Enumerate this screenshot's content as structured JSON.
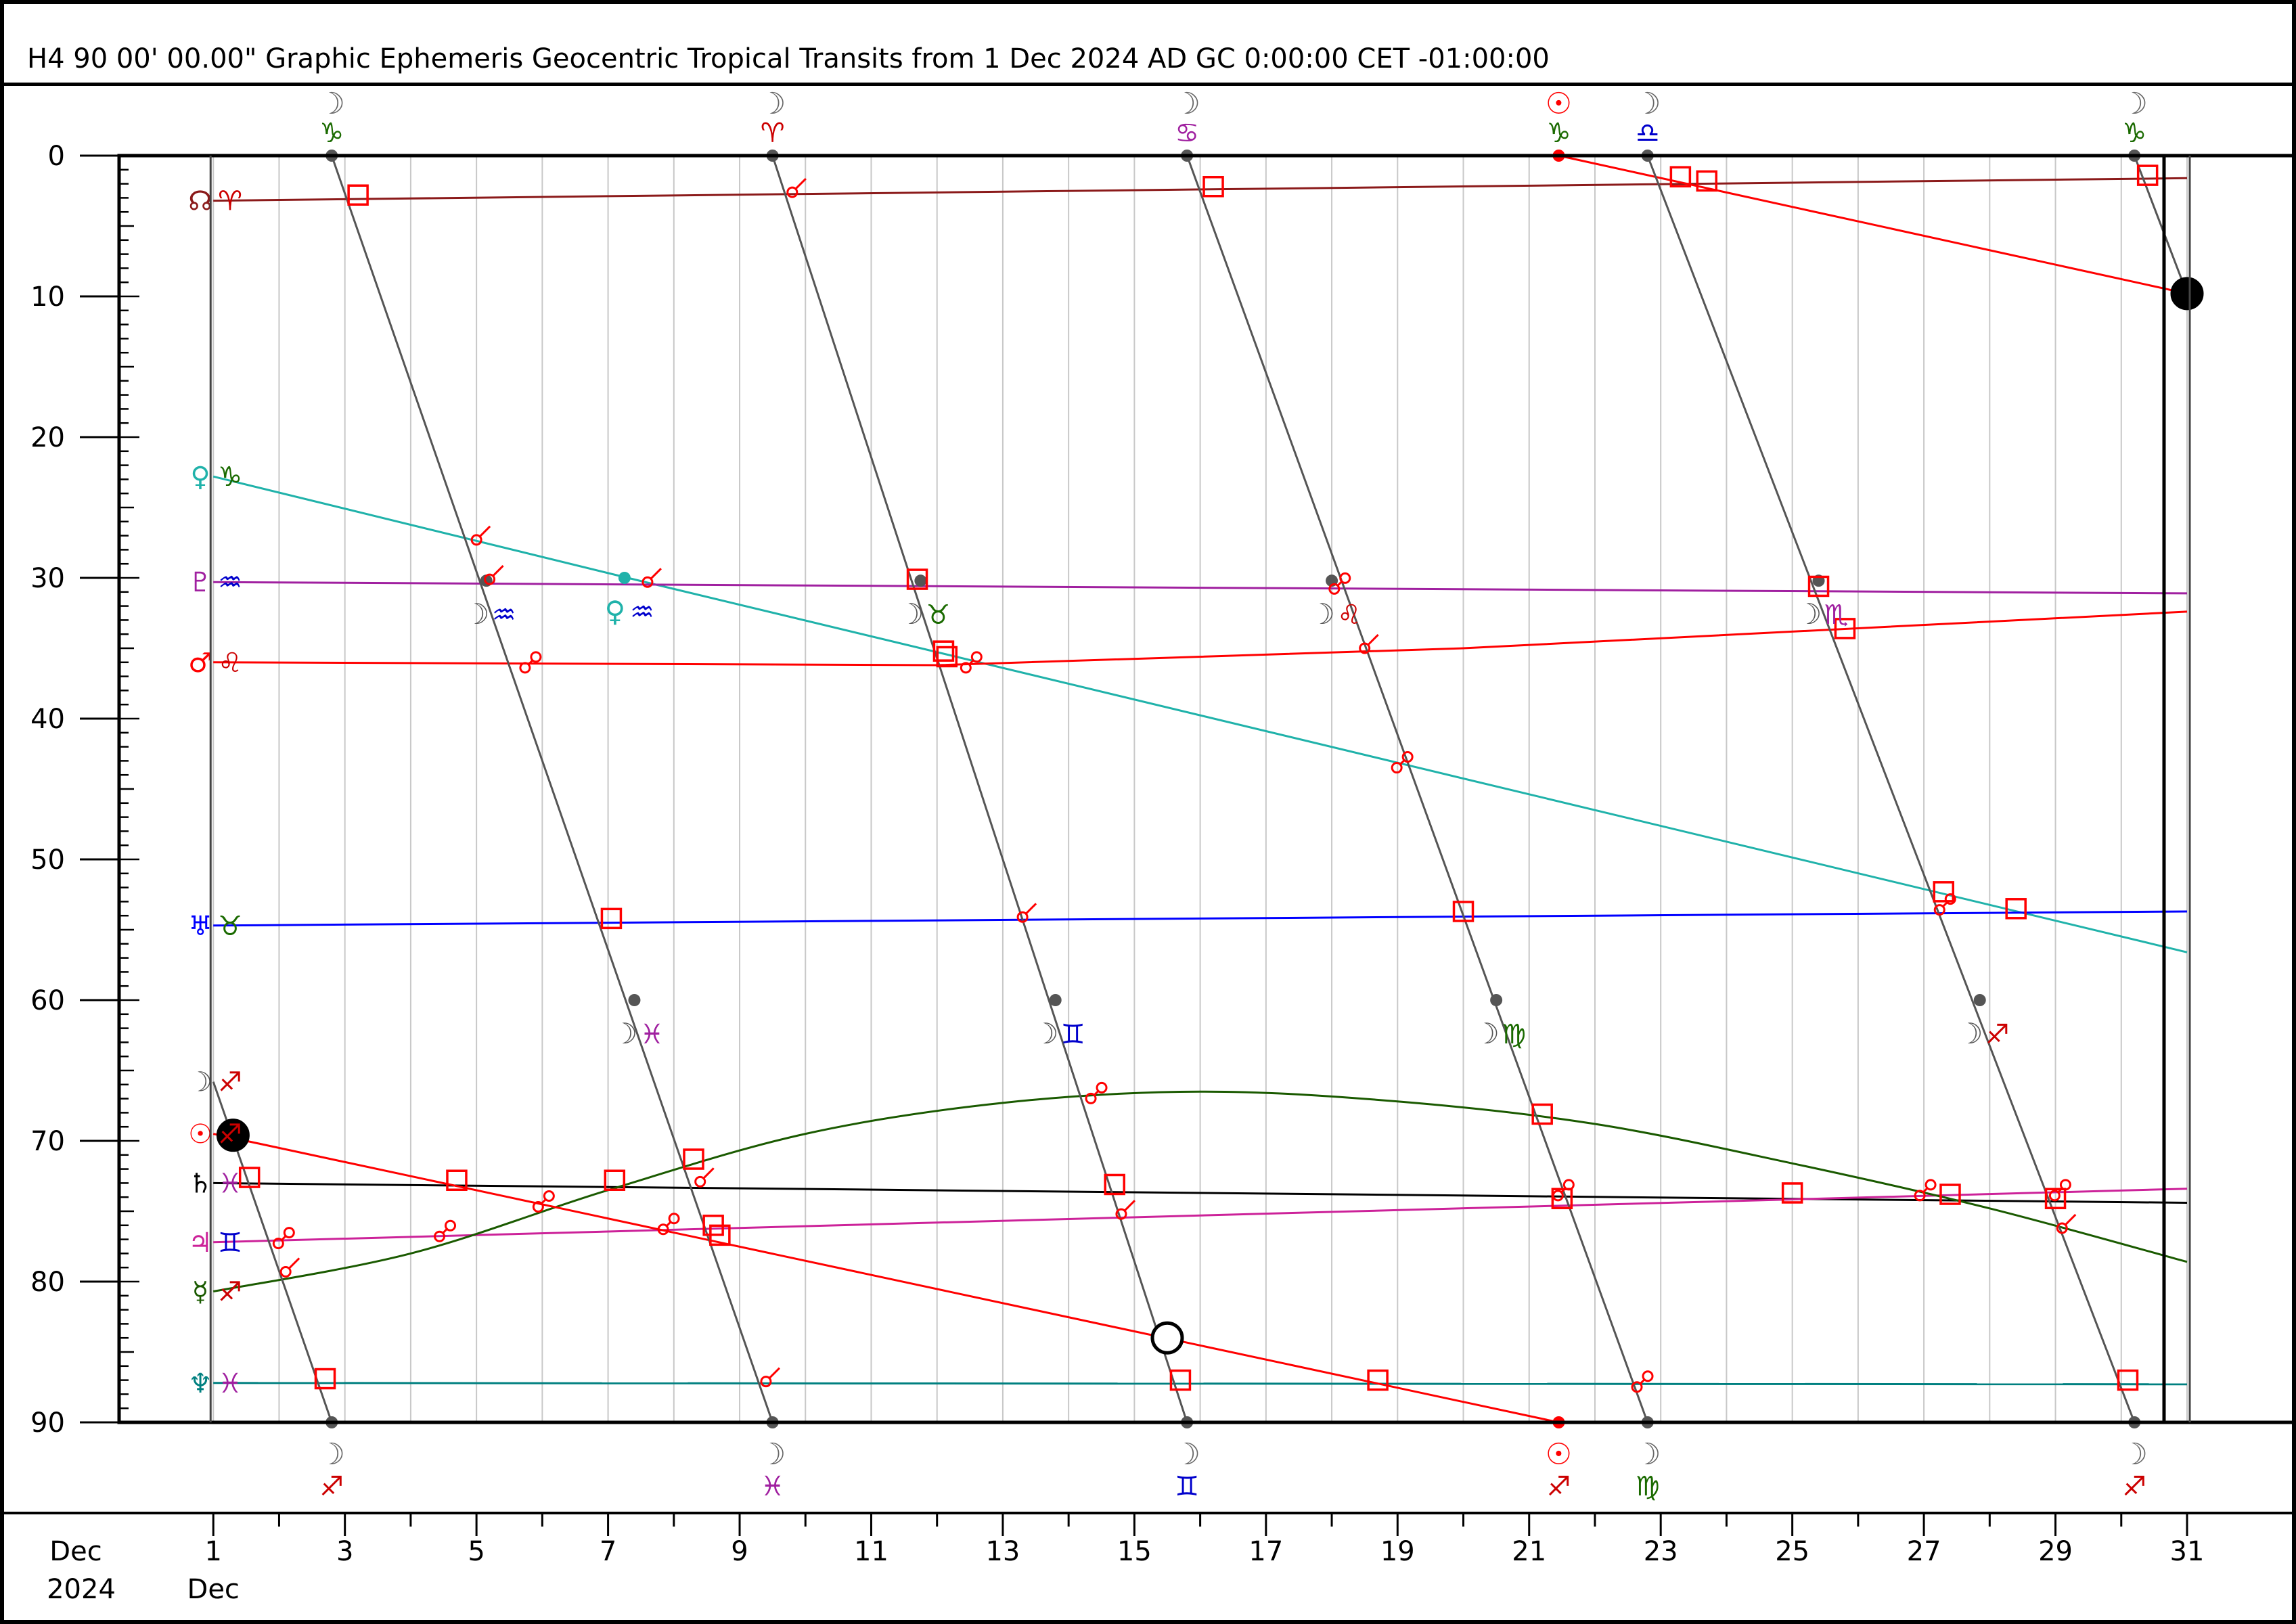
{
  "title": "H4   90 00' 00.00\" Graphic Ephemeris Geocentric Tropical Transits from 1 Dec 2024 AD GC 0:00:00 CET -01:00:00",
  "colors": {
    "moon": "#555555",
    "sun": "#ff0000",
    "venus": "#20b2aa",
    "pluto": "#a020a0",
    "mars": "#ff0000",
    "uranus": "#0000ff",
    "saturn": "#000000",
    "jupiter": "#cc2299",
    "mercury": "#1a5a00",
    "neptune": "#008080",
    "node": "#8b1a1a",
    "aspect": "#ff0000",
    "grid": "#c8c8c8"
  },
  "chart_data": {
    "type": "line",
    "xlabel": "",
    "ylabel": "",
    "xlim": [
      0,
      31
    ],
    "ylim": [
      0,
      90
    ],
    "x_tick_labels": [
      {
        "day": 1,
        "label": "1",
        "sub": "Dec"
      },
      {
        "day": 3,
        "label": "3"
      },
      {
        "day": 5,
        "label": "5"
      },
      {
        "day": 7,
        "label": "7"
      },
      {
        "day": 9,
        "label": "9"
      },
      {
        "day": 11,
        "label": "11"
      },
      {
        "day": 13,
        "label": "13"
      },
      {
        "day": 15,
        "label": "15"
      },
      {
        "day": 17,
        "label": "17"
      },
      {
        "day": 19,
        "label": "19"
      },
      {
        "day": 21,
        "label": "21"
      },
      {
        "day": 23,
        "label": "23"
      },
      {
        "day": 25,
        "label": "25"
      },
      {
        "day": 27,
        "label": "27"
      },
      {
        "day": 29,
        "label": "29"
      },
      {
        "day": 31,
        "label": "31"
      }
    ],
    "x_corner_label": [
      "Dec",
      "2024"
    ],
    "y_ticks": [
      0,
      10,
      20,
      30,
      40,
      50,
      60,
      70,
      80,
      90
    ],
    "series": [
      {
        "name": "☊ ♈",
        "glyph": "☊",
        "sign": "♈",
        "color": "#8b1a1a",
        "signColor": "#cc0000",
        "points": [
          [
            1,
            3.2
          ],
          [
            31,
            1.6
          ]
        ]
      },
      {
        "name": "♀ ♑",
        "glyph": "♀",
        "sign": "♑",
        "color": "#20b2aa",
        "signColor": "#1a6a00",
        "points": [
          [
            1,
            22.8
          ],
          [
            7.3,
            30.0
          ],
          [
            31,
            56.6
          ]
        ]
      },
      {
        "name": "♇ ♒",
        "glyph": "♇",
        "sign": "♒",
        "color": "#a020a0",
        "signColor": "#0000cc",
        "points": [
          [
            1,
            30.3
          ],
          [
            31,
            31.1
          ]
        ]
      },
      {
        "name": "♂ ♌",
        "glyph": "♂",
        "sign": "♌",
        "color": "#ff0000",
        "signColor": "#cc0000",
        "points": [
          [
            1,
            36.0
          ],
          [
            12,
            36.2
          ],
          [
            20,
            35.0
          ],
          [
            31,
            32.4
          ]
        ]
      },
      {
        "name": "♅ ♉",
        "glyph": "♅",
        "sign": "♉",
        "color": "#0000ff",
        "signColor": "#1a6a00",
        "points": [
          [
            1,
            54.7
          ],
          [
            31,
            53.7
          ]
        ]
      },
      {
        "name": "♄ ♓",
        "glyph": "♄",
        "sign": "♓",
        "color": "#000000",
        "signColor": "#a020a0",
        "points": [
          [
            1,
            73.0
          ],
          [
            31,
            74.4
          ]
        ]
      },
      {
        "name": "♃ ♊",
        "glyph": "♃",
        "sign": "♊",
        "color": "#cc2299",
        "signColor": "#0000cc",
        "points": [
          [
            1,
            77.2
          ],
          [
            31,
            73.4
          ]
        ]
      },
      {
        "name": "☿ ♐",
        "glyph": "☿",
        "sign": "♐",
        "color": "#1a5a00",
        "signColor": "#cc0000",
        "points": [
          [
            1,
            80.7
          ],
          [
            4,
            78.0
          ],
          [
            7,
            73.5
          ],
          [
            10,
            69.5
          ],
          [
            13,
            67.3
          ],
          [
            16,
            66.5
          ],
          [
            19,
            67.2
          ],
          [
            22,
            68.8
          ],
          [
            25,
            71.6
          ],
          [
            28,
            74.8
          ],
          [
            31,
            78.6
          ]
        ]
      },
      {
        "name": "♆ ♓",
        "glyph": "♆",
        "sign": "♓",
        "color": "#008080",
        "signColor": "#a020a0",
        "points": [
          [
            1,
            87.2
          ],
          [
            31,
            87.3
          ]
        ]
      },
      {
        "name": "☉ ♐",
        "glyph": "☉",
        "sign": "♐",
        "color": "#ff0000",
        "signColor": "#cc0000",
        "points": [
          [
            1,
            69.5
          ],
          [
            21.45,
            90
          ]
        ]
      },
      {
        "name": "☉ ♑",
        "glyph": "",
        "sign": "",
        "color": "#ff0000",
        "signColor": "#1a6a00",
        "points": [
          [
            21.45,
            0
          ],
          [
            31,
            9.8
          ]
        ]
      },
      {
        "name": "☽ ♐",
        "glyph": "☽",
        "sign": "♐",
        "color": "#555555",
        "signColor": "#cc0000",
        "points": [
          [
            1,
            65.8
          ],
          [
            2.8,
            90
          ]
        ]
      },
      {
        "name": "moon-2",
        "glyph": "",
        "sign": "",
        "color": "#555555",
        "points": [
          [
            2.8,
            0
          ],
          [
            9.5,
            90
          ]
        ]
      },
      {
        "name": "moon-3",
        "glyph": "",
        "sign": "",
        "color": "#555555",
        "points": [
          [
            9.5,
            0
          ],
          [
            15.8,
            90
          ]
        ]
      },
      {
        "name": "moon-4",
        "glyph": "",
        "sign": "",
        "color": "#555555",
        "points": [
          [
            15.8,
            0
          ],
          [
            22.8,
            90
          ]
        ]
      },
      {
        "name": "moon-5",
        "glyph": "",
        "sign": "",
        "color": "#555555",
        "points": [
          [
            22.8,
            0
          ],
          [
            30.2,
            90
          ]
        ]
      },
      {
        "name": "moon-6",
        "glyph": "",
        "sign": "",
        "color": "#555555",
        "points": [
          [
            30.2,
            0
          ],
          [
            31,
            9.8
          ]
        ]
      }
    ],
    "top_ingresses": [
      {
        "x": 2.8,
        "glyph": "☽",
        "sign": "♑",
        "signColor": "#1a6a00"
      },
      {
        "x": 9.5,
        "glyph": "☽",
        "sign": "♈",
        "signColor": "#cc0000"
      },
      {
        "x": 15.8,
        "glyph": "☽",
        "sign": "♋",
        "signColor": "#a020a0"
      },
      {
        "x": 21.45,
        "glyph": "☉",
        "sign": "♑",
        "signColor": "#1a6a00",
        "glyphColor": "#ff0000"
      },
      {
        "x": 22.8,
        "glyph": "☽",
        "sign": "♎",
        "signColor": "#0000cc"
      },
      {
        "x": 30.2,
        "glyph": "☽",
        "sign": "♑",
        "signColor": "#1a6a00"
      }
    ],
    "bottom_ingresses": [
      {
        "x": 2.8,
        "glyph": "☽",
        "sign": "♐",
        "signColor": "#cc0000"
      },
      {
        "x": 9.5,
        "glyph": "☽",
        "sign": "♓",
        "signColor": "#a020a0"
      },
      {
        "x": 15.8,
        "glyph": "☽",
        "sign": "♊",
        "signColor": "#0000cc"
      },
      {
        "x": 21.45,
        "glyph": "☉",
        "sign": "♐",
        "signColor": "#cc0000",
        "glyphColor": "#ff0000"
      },
      {
        "x": 22.8,
        "glyph": "☽",
        "sign": "♍",
        "signColor": "#1a6a00"
      },
      {
        "x": 30.2,
        "glyph": "☽",
        "sign": "♐",
        "signColor": "#cc0000"
      }
    ],
    "mid_ingresses": [
      {
        "x": 5.15,
        "y": 30.2,
        "glyph": "☽",
        "sign": "♒",
        "signColor": "#0000cc",
        "glyphColor": "#555555"
      },
      {
        "x": 7.25,
        "y": 30.0,
        "glyph": "♀",
        "sign": "♒",
        "signColor": "#0000cc",
        "glyphColor": "#20b2aa"
      },
      {
        "x": 11.75,
        "y": 30.2,
        "glyph": "☽",
        "sign": "♉",
        "signColor": "#1a6a00",
        "glyphColor": "#555555"
      },
      {
        "x": 18.0,
        "y": 30.2,
        "glyph": "☽",
        "sign": "♌",
        "signColor": "#cc0000",
        "glyphColor": "#555555"
      },
      {
        "x": 25.4,
        "y": 30.2,
        "glyph": "☽",
        "sign": "♏",
        "signColor": "#a020a0",
        "glyphColor": "#555555"
      },
      {
        "x": 7.4,
        "y": 60,
        "glyph": "☽",
        "sign": "♓",
        "signColor": "#a020a0",
        "glyphColor": "#555555"
      },
      {
        "x": 13.8,
        "y": 60,
        "glyph": "☽",
        "sign": "♊",
        "signColor": "#0000cc",
        "glyphColor": "#555555"
      },
      {
        "x": 20.5,
        "y": 60,
        "glyph": "☽",
        "sign": "♍",
        "signColor": "#1a6a00",
        "glyphColor": "#555555"
      },
      {
        "x": 27.85,
        "y": 60,
        "glyph": "☽",
        "sign": "♐",
        "signColor": "#cc0000",
        "glyphColor": "#555555"
      }
    ],
    "lunar_phases": [
      {
        "x": 1.3,
        "y": 69.6,
        "phase": "new"
      },
      {
        "x": 15.5,
        "y": 84.0,
        "phase": "full"
      },
      {
        "x": 31.0,
        "y": 9.8,
        "phase": "new"
      }
    ],
    "aspects": {
      "square": [
        [
          3.2,
          2.8
        ],
        [
          16.2,
          2.2
        ],
        [
          23.3,
          1.5
        ],
        [
          23.7,
          1.8
        ],
        [
          30.4,
          1.4
        ],
        [
          11.7,
          30.1
        ],
        [
          25.4,
          30.6
        ],
        [
          12.1,
          35.2
        ],
        [
          12.15,
          35.6
        ],
        [
          25.8,
          33.6
        ],
        [
          7.05,
          54.2
        ],
        [
          20.0,
          53.7
        ],
        [
          27.3,
          52.3
        ],
        [
          28.4,
          53.5
        ],
        [
          21.2,
          68.1
        ],
        [
          1.55,
          72.6
        ],
        [
          4.7,
          72.8
        ],
        [
          7.1,
          72.8
        ],
        [
          8.3,
          71.3
        ],
        [
          14.7,
          73.1
        ],
        [
          8.6,
          76.0
        ],
        [
          8.7,
          76.7
        ],
        [
          21.5,
          74.1
        ],
        [
          25.0,
          73.7
        ],
        [
          27.4,
          73.8
        ],
        [
          29.0,
          74.1
        ],
        [
          2.7,
          86.9
        ],
        [
          15.7,
          87.0
        ],
        [
          18.7,
          87.0
        ],
        [
          30.1,
          87.0
        ]
      ],
      "sextile": [
        [
          9.8,
          2.6
        ],
        [
          5.0,
          27.3
        ],
        [
          5.2,
          30.1
        ],
        [
          7.6,
          30.3
        ],
        [
          18.5,
          35.0
        ],
        [
          13.3,
          54.1
        ],
        [
          2.1,
          79.3
        ],
        [
          8.4,
          72.9
        ],
        [
          14.8,
          75.2
        ],
        [
          9.4,
          87.1
        ],
        [
          29.1,
          76.2
        ]
      ],
      "opposition": [
        [
          5.8,
          36.1
        ],
        [
          12.5,
          36.1
        ],
        [
          18.1,
          30.5
        ],
        [
          19.05,
          43.2
        ],
        [
          14.4,
          66.7
        ],
        [
          27.3,
          53.3
        ],
        [
          2.05,
          77.0
        ],
        [
          4.5,
          76.5
        ],
        [
          6.0,
          74.4
        ],
        [
          7.9,
          76.0
        ],
        [
          21.5,
          73.6
        ],
        [
          27.0,
          73.6
        ],
        [
          29.05,
          73.6
        ],
        [
          22.7,
          87.2
        ]
      ]
    }
  }
}
